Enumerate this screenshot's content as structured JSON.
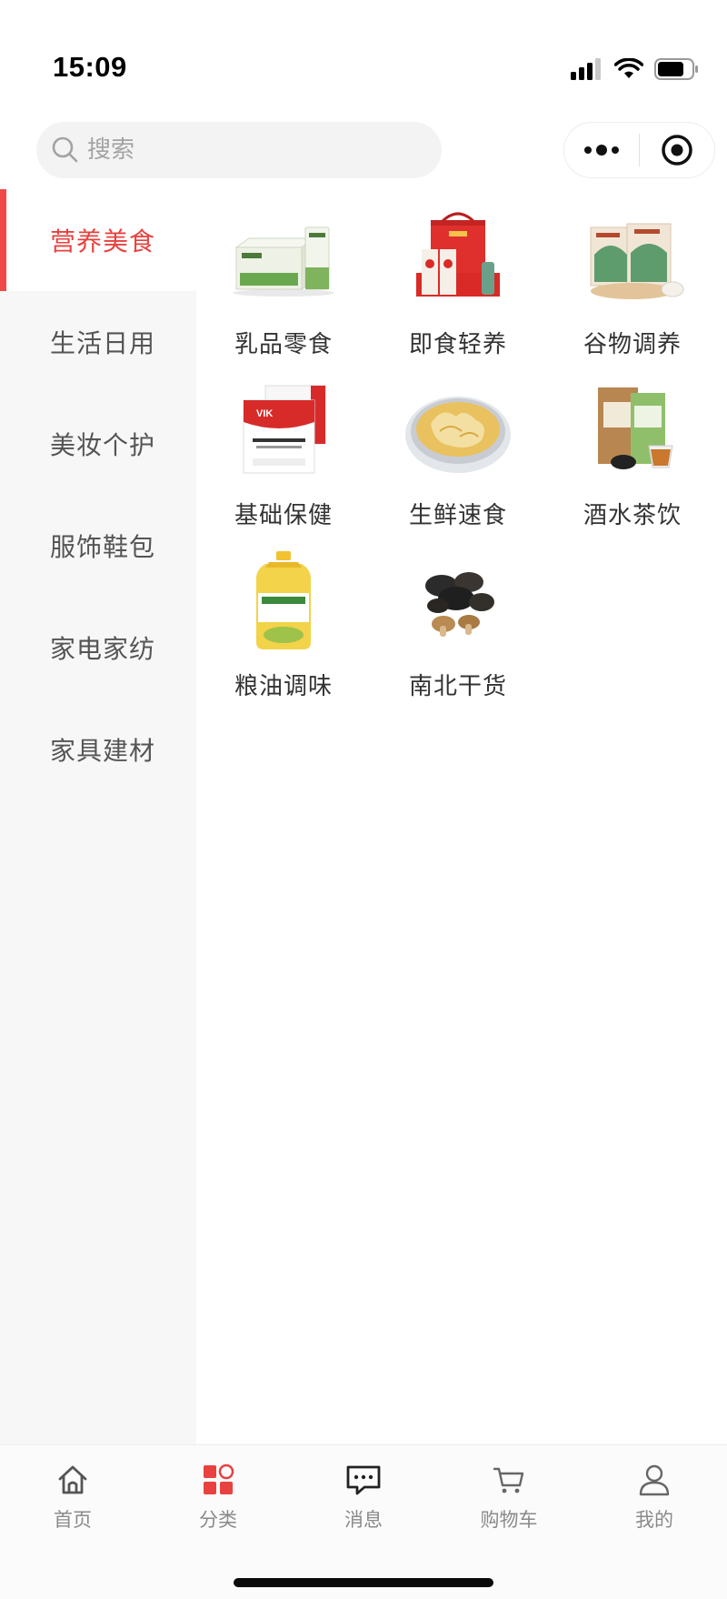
{
  "status_bar": {
    "time": "15:09"
  },
  "search": {
    "placeholder": "搜索"
  },
  "sidebar": {
    "items": [
      {
        "label": "营养美食",
        "active": true
      },
      {
        "label": "生活日用",
        "active": false
      },
      {
        "label": "美妆个护",
        "active": false
      },
      {
        "label": "服饰鞋包",
        "active": false
      },
      {
        "label": "家电家纺",
        "active": false
      },
      {
        "label": "家具建材",
        "active": false
      }
    ]
  },
  "categories": [
    {
      "label": "乳品零食",
      "icon": "dairy-snacks-image"
    },
    {
      "label": "即食轻养",
      "icon": "instant-nutrition-image"
    },
    {
      "label": "谷物调养",
      "icon": "grain-nutrition-image"
    },
    {
      "label": "基础保健",
      "icon": "basic-health-image"
    },
    {
      "label": "生鲜速食",
      "icon": "fresh-food-image"
    },
    {
      "label": "酒水茶饮",
      "icon": "drinks-tea-image"
    },
    {
      "label": "粮油调味",
      "icon": "grain-oil-image"
    },
    {
      "label": "南北干货",
      "icon": "dried-goods-image"
    }
  ],
  "tabbar": {
    "items": [
      {
        "label": "首页",
        "icon": "home-icon",
        "active": false
      },
      {
        "label": "分类",
        "icon": "category-icon",
        "active": true
      },
      {
        "label": "消息",
        "icon": "message-icon",
        "active": false
      },
      {
        "label": "购物车",
        "icon": "cart-icon",
        "active": false
      },
      {
        "label": "我的",
        "icon": "user-icon",
        "active": false
      }
    ]
  },
  "colors": {
    "accent": "#e8413f",
    "sidebar_bg": "#f7f7f7",
    "text": "#333333",
    "tab_inactive": "#8a8a8a"
  }
}
